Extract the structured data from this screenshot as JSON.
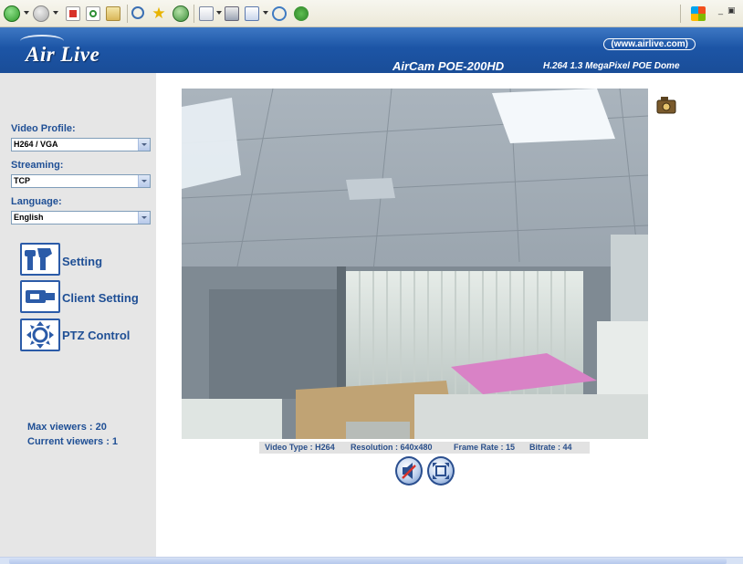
{
  "header": {
    "logo": "Air Live",
    "url": "(www.airlive.com)",
    "model": "AirCam POE-200HD",
    "model_desc": "H.264 1.3 MegaPixel POE Dome"
  },
  "sidebar": {
    "video_profile_label": "Video Profile:",
    "video_profile_value": "H264 / VGA",
    "streaming_label": "Streaming:",
    "streaming_value": "TCP",
    "language_label": "Language:",
    "language_value": "English",
    "menu": [
      {
        "label": "Setting",
        "icon": "tools-icon"
      },
      {
        "label": "Client Setting",
        "icon": "plug-icon"
      },
      {
        "label": "PTZ Control",
        "icon": "ptz-icon"
      }
    ],
    "max_viewers": "Max viewers : 20",
    "current_viewers": "Current viewers :  1"
  },
  "video_status": {
    "type": "Video Type : H264",
    "resolution": "Resolution : 640x480",
    "frame_rate": "Frame Rate : 15",
    "bitrate": "Bitrate : 44"
  },
  "colors": {
    "banner": "#1c55a6",
    "sidebar_bg": "#e6e6e6",
    "link_text": "#1f4f95"
  }
}
